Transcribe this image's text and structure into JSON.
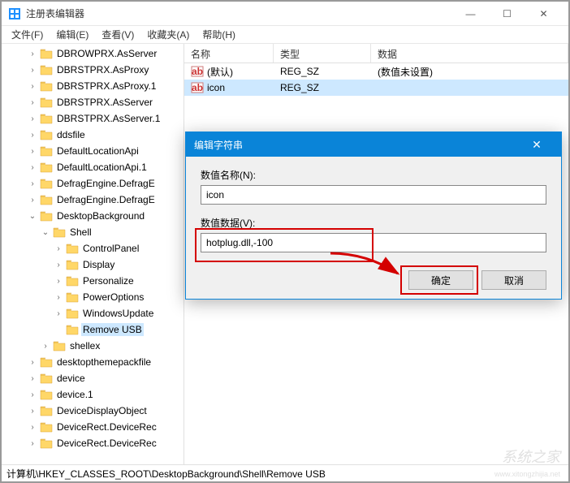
{
  "window": {
    "title": "注册表编辑器",
    "minimize": "—",
    "maximize": "☐",
    "close": "✕"
  },
  "menu": {
    "file": "文件(F)",
    "edit": "编辑(E)",
    "view": "查看(V)",
    "favorites": "收藏夹(A)",
    "help": "帮助(H)"
  },
  "tree": [
    {
      "indent": 2,
      "expander": ">",
      "label": "DBROWPRX.AsServer"
    },
    {
      "indent": 2,
      "expander": ">",
      "label": "DBRSTPRX.AsProxy"
    },
    {
      "indent": 2,
      "expander": ">",
      "label": "DBRSTPRX.AsProxy.1"
    },
    {
      "indent": 2,
      "expander": ">",
      "label": "DBRSTPRX.AsServer"
    },
    {
      "indent": 2,
      "expander": ">",
      "label": "DBRSTPRX.AsServer.1"
    },
    {
      "indent": 2,
      "expander": ">",
      "label": "ddsfile"
    },
    {
      "indent": 2,
      "expander": ">",
      "label": "DefaultLocationApi"
    },
    {
      "indent": 2,
      "expander": ">",
      "label": "DefaultLocationApi.1"
    },
    {
      "indent": 2,
      "expander": ">",
      "label": "DefragEngine.DefragE"
    },
    {
      "indent": 2,
      "expander": ">",
      "label": "DefragEngine.DefragE"
    },
    {
      "indent": 2,
      "expander": "v",
      "label": "DesktopBackground"
    },
    {
      "indent": 3,
      "expander": "v",
      "label": "Shell"
    },
    {
      "indent": 4,
      "expander": ">",
      "label": "ControlPanel"
    },
    {
      "indent": 4,
      "expander": ">",
      "label": "Display"
    },
    {
      "indent": 4,
      "expander": ">",
      "label": "Personalize"
    },
    {
      "indent": 4,
      "expander": ">",
      "label": "PowerOptions"
    },
    {
      "indent": 4,
      "expander": ">",
      "label": "WindowsUpdate"
    },
    {
      "indent": 4,
      "expander": "",
      "label": "Remove USB",
      "selected": true
    },
    {
      "indent": 3,
      "expander": ">",
      "label": "shellex"
    },
    {
      "indent": 2,
      "expander": ">",
      "label": "desktopthemepackfile"
    },
    {
      "indent": 2,
      "expander": ">",
      "label": "device"
    },
    {
      "indent": 2,
      "expander": ">",
      "label": "device.1"
    },
    {
      "indent": 2,
      "expander": ">",
      "label": "DeviceDisplayObject"
    },
    {
      "indent": 2,
      "expander": ">",
      "label": "DeviceRect.DeviceRec"
    },
    {
      "indent": 2,
      "expander": ">",
      "label": "DeviceRect.DeviceRec"
    }
  ],
  "list": {
    "columns": {
      "name": "名称",
      "type": "类型",
      "data": "数据"
    },
    "rows": [
      {
        "name": "(默认)",
        "type": "REG_SZ",
        "data": "(数值未设置)",
        "selected": false
      },
      {
        "name": "icon",
        "type": "REG_SZ",
        "data": "",
        "selected": true
      }
    ]
  },
  "dialog": {
    "title": "编辑字符串",
    "name_label": "数值名称(N):",
    "name_value": "icon",
    "data_label": "数值数据(V):",
    "data_value": "hotplug.dll,-100",
    "ok": "确定",
    "cancel": "取消"
  },
  "statusbar": "计算机\\HKEY_CLASSES_ROOT\\DesktopBackground\\Shell\\Remove USB",
  "watermark": {
    "main": "系统之家",
    "sub": "www.xitongzhijia.net"
  }
}
